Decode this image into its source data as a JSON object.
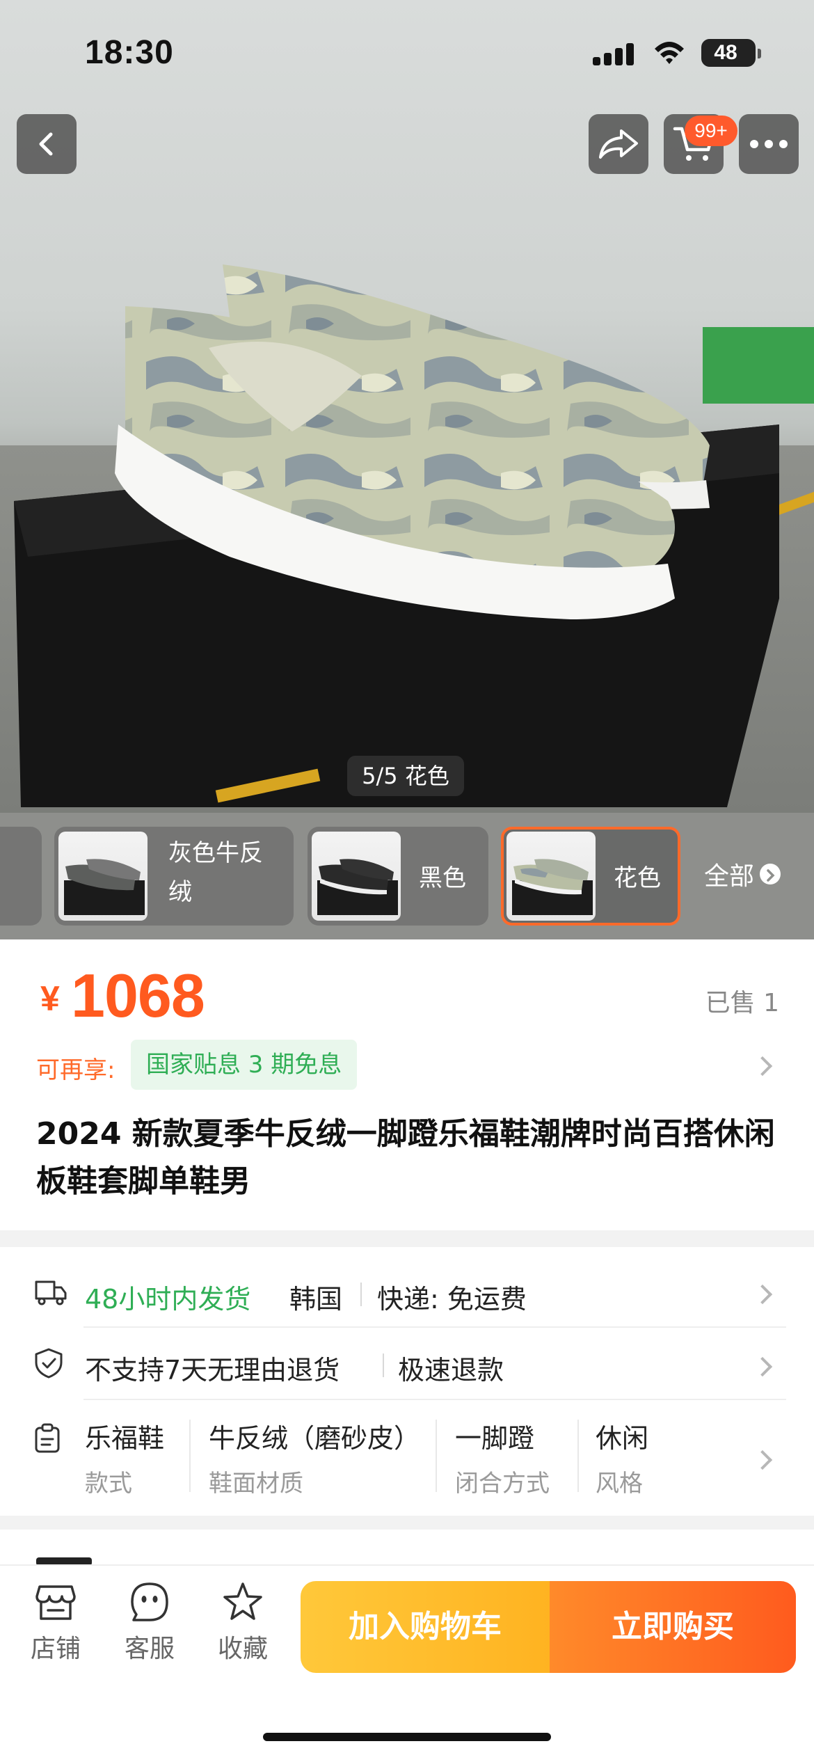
{
  "status_bar": {
    "time": "18:30",
    "battery": "48"
  },
  "header": {
    "cart_badge": "99+"
  },
  "gallery": {
    "counter": "5/5 花色"
  },
  "variants": {
    "items": [
      {
        "label": "灰色牛反绒"
      },
      {
        "label": "黑色"
      },
      {
        "label": "花色",
        "selected": true
      }
    ],
    "all_label": "全部"
  },
  "price": {
    "currency": "¥",
    "amount": "1068",
    "sold": "已售 1"
  },
  "perk": {
    "label": "可再享:",
    "tag": "国家贴息 3 期免息"
  },
  "product": {
    "title": "2024 新款夏季牛反绒一脚蹬乐福鞋潮牌时尚百搭休闲板鞋套脚单鞋男"
  },
  "shipping": {
    "dispatch": "48小时内发货",
    "origin": "韩国",
    "express": "快递: 免运费"
  },
  "returns": {
    "policy": "不支持7天无理由退货",
    "refund": "极速退款"
  },
  "attributes": [
    {
      "value": "乐福鞋",
      "name": "款式"
    },
    {
      "value": "牛反绒（磨砂皮）",
      "name": "鞋面材质"
    },
    {
      "value": "一脚蹬",
      "name": "闭合方式"
    },
    {
      "value": "休闲",
      "name": "风格"
    }
  ],
  "bottom_bar": {
    "store": "店铺",
    "service": "客服",
    "favorite": "收藏",
    "add_to_cart": "加入购物车",
    "buy_now": "立即购买"
  },
  "colors": {
    "accent": "#ff5a1f",
    "green": "#2fae55",
    "cart_yellow": "#ffb321",
    "buy_orange": "#ff5b1e"
  }
}
